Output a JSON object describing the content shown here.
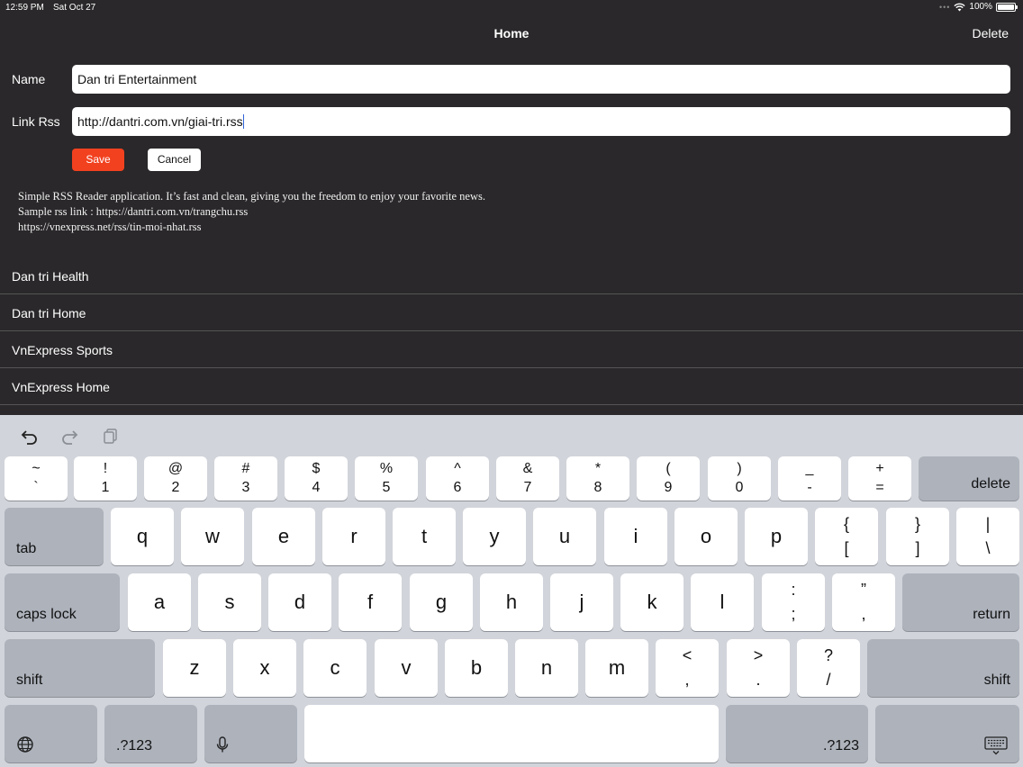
{
  "status": {
    "time": "12:59 PM",
    "date": "Sat Oct 27",
    "battery": "100%",
    "battery_level": 1.0
  },
  "nav": {
    "title": "Home",
    "delete_label": "Delete"
  },
  "form": {
    "name_label": "Name",
    "name_value": "Dan tri Entertainment",
    "link_label": "Link Rss",
    "link_value": "http://dantri.com.vn/giai-tri.rss",
    "save_label": "Save",
    "cancel_label": "Cancel"
  },
  "description": {
    "line1": "Simple RSS Reader application. It’s fast and clean, giving you the freedom to enjoy your favorite news.",
    "line2": "Sample rss link : https://dantri.com.vn/trangchu.rss",
    "line3": "https://vnexpress.net/rss/tin-moi-nhat.rss"
  },
  "feeds": [
    {
      "label": "Dan tri Health"
    },
    {
      "label": "Dan tri Home"
    },
    {
      "label": "VnExpress Sports"
    },
    {
      "label": "VnExpress Home"
    }
  ],
  "keyboard": {
    "row1": [
      {
        "top": "~",
        "bot": "`"
      },
      {
        "top": "!",
        "bot": "1"
      },
      {
        "top": "@",
        "bot": "2"
      },
      {
        "top": "#",
        "bot": "3"
      },
      {
        "top": "$",
        "bot": "4"
      },
      {
        "top": "%",
        "bot": "5"
      },
      {
        "top": "^",
        "bot": "6"
      },
      {
        "top": "&",
        "bot": "7"
      },
      {
        "top": "*",
        "bot": "8"
      },
      {
        "top": "(",
        "bot": "9"
      },
      {
        "top": ")",
        "bot": "0"
      },
      {
        "top": "_",
        "bot": "-"
      },
      {
        "top": "+",
        "bot": "="
      }
    ],
    "delete_label": "delete",
    "tab_label": "tab",
    "row2": [
      "q",
      "w",
      "e",
      "r",
      "t",
      "y",
      "u",
      "i",
      "o",
      "p"
    ],
    "row2_symbols": [
      {
        "top": "{",
        "bot": "["
      },
      {
        "top": "}",
        "bot": "]"
      },
      {
        "top": "|",
        "bot": "\\"
      }
    ],
    "caps_label": "caps lock",
    "row3": [
      "a",
      "s",
      "d",
      "f",
      "g",
      "h",
      "j",
      "k",
      "l"
    ],
    "row3_symbols": [
      {
        "top": ":",
        "bot": ";"
      },
      {
        "top": "”",
        "bot": ","
      }
    ],
    "return_label": "return",
    "shift_label": "shift",
    "row4": [
      "z",
      "x",
      "c",
      "v",
      "b",
      "n",
      "m"
    ],
    "row4_symbols": [
      {
        "top": "<",
        "bot": ","
      },
      {
        "top": ">",
        "bot": "."
      },
      {
        "top": "?",
        "bot": "/"
      }
    ],
    "num_label": ".?123",
    "icons": {
      "undo": "undo-icon",
      "redo": "redo-icon",
      "paste": "paste-icon",
      "globe": "globe-icon",
      "mic": "microphone-icon",
      "hide": "keyboard-dismiss-icon"
    }
  }
}
